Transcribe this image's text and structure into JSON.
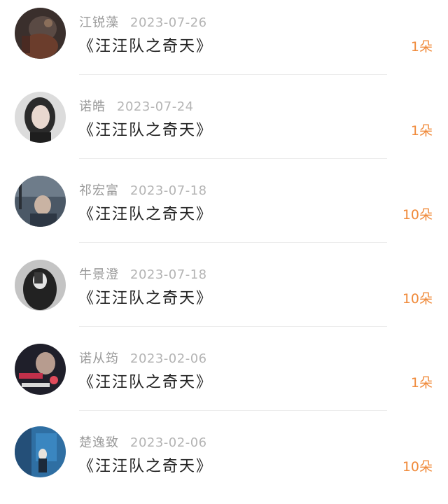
{
  "colors": {
    "amount": "#f08a3a",
    "title": "#222222",
    "meta": "#9a9a9a"
  },
  "gifts": [
    {
      "name": "江锐藻",
      "date": "2023-07-26",
      "title": "《汪汪队之奇天》",
      "amount": "1朵",
      "avatar": "avatar-dark-figure"
    },
    {
      "name": "诺皓",
      "date": "2023-07-24",
      "title": "《汪汪队之奇天》",
      "amount": "1朵",
      "avatar": "avatar-girl-portrait"
    },
    {
      "name": "祁宏富",
      "date": "2023-07-18",
      "title": "《汪汪队之奇天》",
      "amount": "10朵",
      "avatar": "avatar-boy-night"
    },
    {
      "name": "牛景澄",
      "date": "2023-07-18",
      "title": "《汪汪队之奇天》",
      "amount": "10朵",
      "avatar": "avatar-girl-mirror"
    },
    {
      "name": "诺从筠",
      "date": "2023-02-06",
      "title": "《汪汪队之奇天》",
      "amount": "1朵",
      "avatar": "avatar-smoke-text"
    },
    {
      "name": "楚逸致",
      "date": "2023-02-06",
      "title": "《汪汪队之奇天》",
      "amount": "10朵",
      "avatar": "avatar-blue-street"
    }
  ]
}
